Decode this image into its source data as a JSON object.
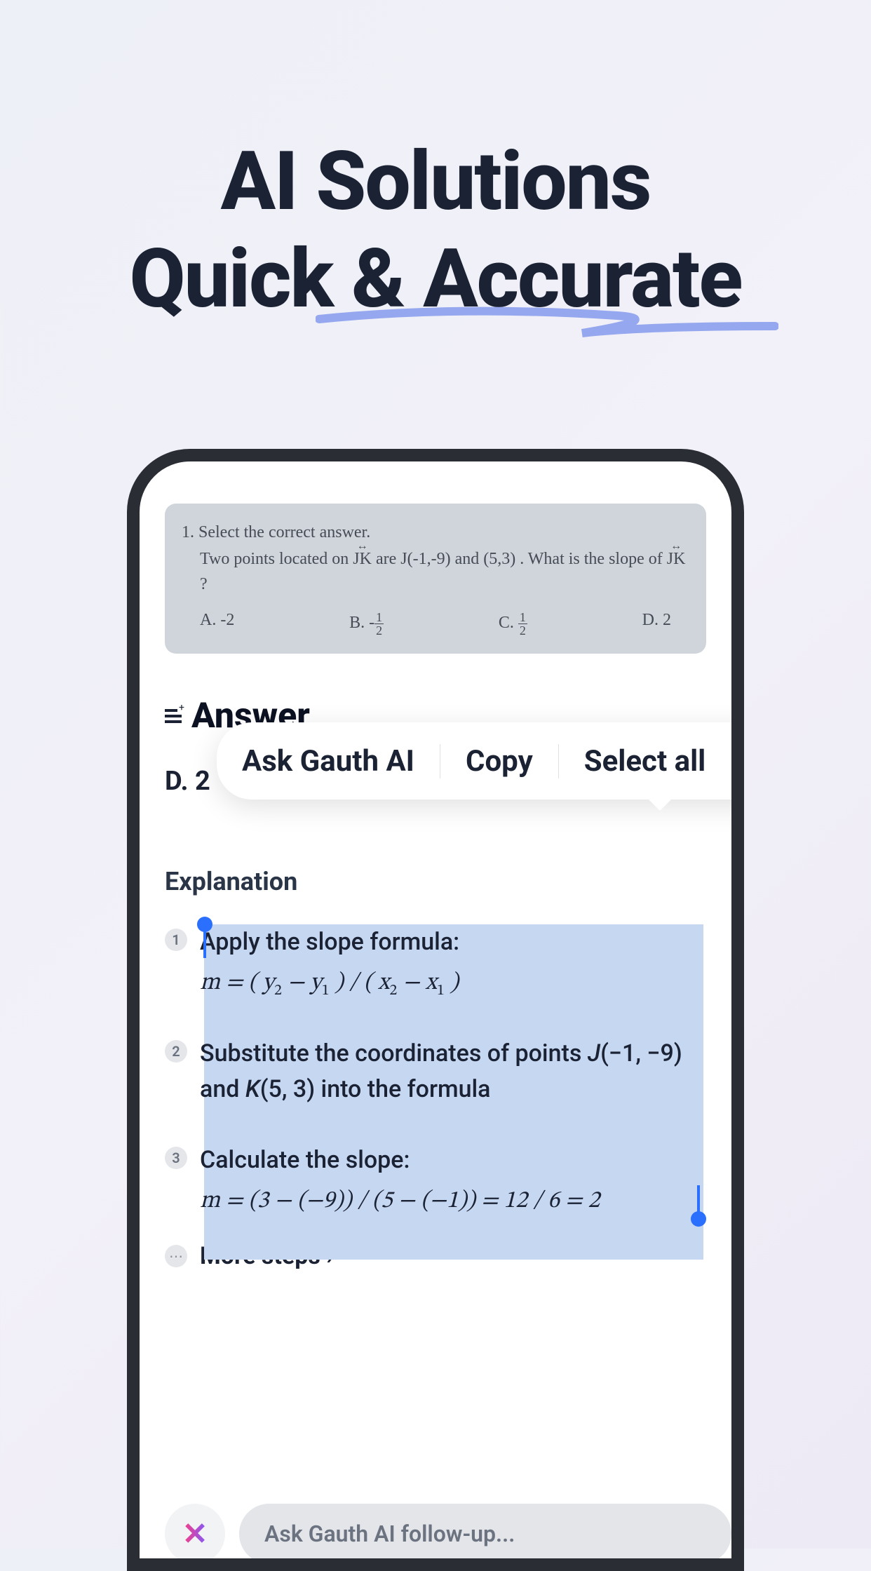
{
  "headline": {
    "line1": "AI Solutions",
    "line2": "Quick & Accurate"
  },
  "question": {
    "title": "1. Select the correct answer.",
    "text_before_jk1": "Two points located on ",
    "jk1": "JK",
    "text_mid": " are  J(-1,-9)  and  (5,3) . What is the slope of ",
    "jk2": "JK",
    "text_after": " ?",
    "options": {
      "a": "A. -2",
      "b_label": "B. -",
      "b_num": "1",
      "b_den": "2",
      "c_label": "C. ",
      "c_num": "1",
      "c_den": "2",
      "d": "D. 2"
    }
  },
  "answer": {
    "heading": "Answer",
    "value": "D. 2"
  },
  "context_menu": {
    "ask": "Ask Gauth AI",
    "copy": "Copy",
    "select_all": "Select all"
  },
  "explanation": {
    "heading": "Explanation",
    "steps": [
      {
        "num": "1",
        "text": "Apply the slope formula:",
        "formula_html": "m = ( y<span class='sub'>2</span> − y<span class='sub'>1</span> ) / ( x<span class='sub'>2</span> − x<span class='sub'>1</span> )"
      },
      {
        "num": "2",
        "text_html": "Substitute the coordinates of points <i>J</i>(−1, −9) and <i>K</i>(5, 3) into the formula",
        "formula_html": ""
      },
      {
        "num": "3",
        "text": "Calculate the slope:",
        "formula_html": "m = (3 − (−9)) / (5 − (−1)) = 12 / 6 = 2"
      }
    ],
    "more": "More steps ›"
  },
  "followup": {
    "placeholder": "Ask Gauth AI follow-up..."
  }
}
